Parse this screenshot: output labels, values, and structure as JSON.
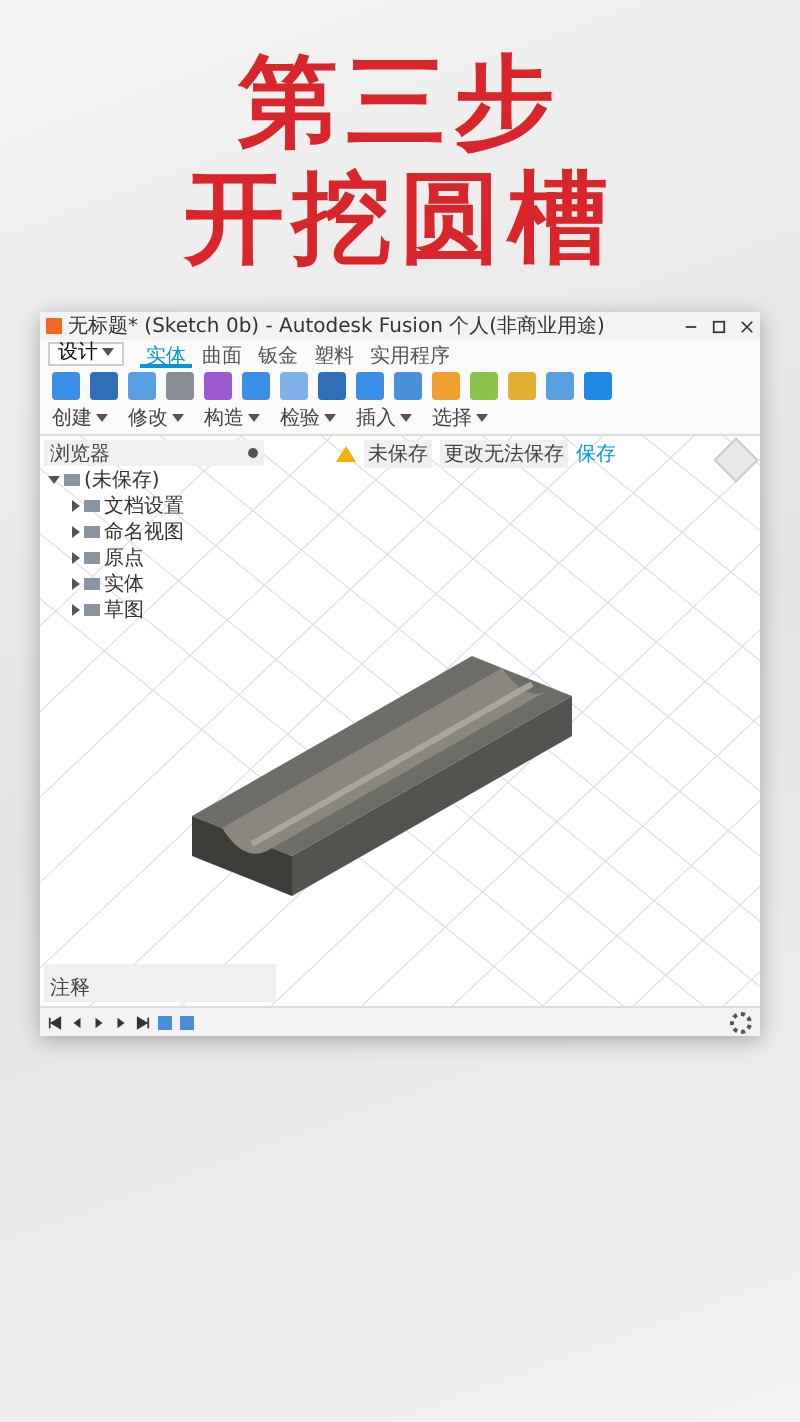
{
  "headline": [
    "第三步",
    "开挖圆槽"
  ],
  "window": {
    "title": "无标题* (Sketch 0b) - Autodesk Fusion 个人(非商业用途)"
  },
  "ribbon": {
    "workspace": "设计",
    "tabs": [
      {
        "label": "实体",
        "selected": true
      },
      {
        "label": "曲面",
        "selected": false
      },
      {
        "label": "钣金",
        "selected": false
      },
      {
        "label": "塑料",
        "selected": false
      },
      {
        "label": "实用程序",
        "selected": false
      }
    ],
    "groups": [
      {
        "label": "创建"
      },
      {
        "label": "修改"
      },
      {
        "label": "构造"
      },
      {
        "label": "检验"
      },
      {
        "label": "插入"
      },
      {
        "label": "选择"
      }
    ]
  },
  "browser": {
    "title": "浏览器",
    "items": [
      {
        "label": "(未保存)",
        "expanded": true,
        "children": [
          {
            "label": "文档设置",
            "expanded": false
          },
          {
            "label": "命名视图",
            "expanded": false
          },
          {
            "label": "原点",
            "expanded": false
          },
          {
            "label": "实体",
            "expanded": false
          },
          {
            "label": "草图",
            "expanded": false
          }
        ]
      }
    ]
  },
  "notice": {
    "warning": "未保存",
    "message": "更改无法保存",
    "action": "保存"
  },
  "comments": {
    "title": "注释"
  }
}
